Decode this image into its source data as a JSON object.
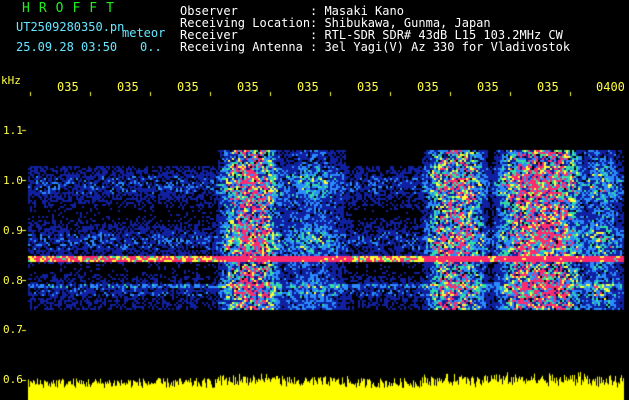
{
  "header": {
    "title": "HROFFT",
    "filename": "UT2509280350.pn",
    "mode": "meteor",
    "datetime": "25.09.28 03:50",
    "counter": "0..",
    "fields": [
      {
        "label": "Observer",
        "value": ": Masaki Kano"
      },
      {
        "label": "Receiving Location",
        "value": ": Shibukawa, Gunma, Japan"
      },
      {
        "label": "Receiver",
        "value": ": RTL-SDR SDR# 43dB L15 103.2MHz CW"
      },
      {
        "label": "Receiving Antenna",
        "value": ": 3el Yagi(V) Az 330 for Vladivostok"
      }
    ]
  },
  "axis": {
    "unit": "kHz",
    "ticks": [
      "1.1",
      "1.0",
      "0.9",
      "0.8",
      "0.7",
      "0.6"
    ],
    "time_labels": [
      "035",
      "035",
      "035",
      "035",
      "035",
      "035",
      "035",
      "035",
      "035",
      "0400"
    ]
  },
  "colors": {
    "background": "#000000",
    "header_text": "#ffffff",
    "title": "#22ee22",
    "axis_text": "#ffff44",
    "noise_low": "#1020a0",
    "noise_mid": "#2a8cff",
    "signal_mid": "#33e0a0",
    "signal_high": "#ffff33",
    "signal_peak": "#ff2a6e",
    "level_trace": "#ffff00"
  }
}
